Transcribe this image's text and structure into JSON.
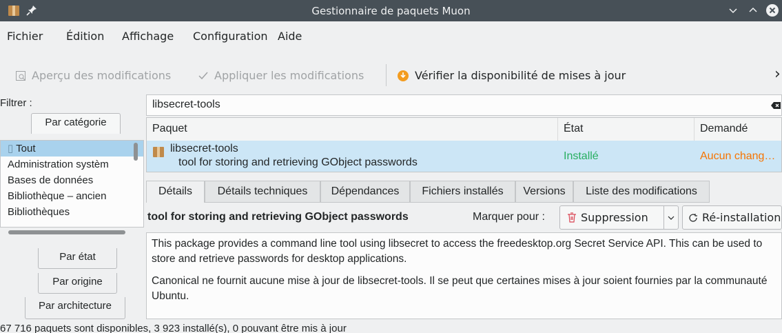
{
  "window": {
    "title": "Gestionnaire de paquets Muon"
  },
  "menubar": {
    "items": [
      "Fichier",
      "Édition",
      "Affichage",
      "Configuration",
      "Aide"
    ]
  },
  "toolbar": {
    "preview_label": "Aperçu des modifications",
    "apply_label": "Appliquer les modifications",
    "check_label": "Vérifier la disponibilité de mises à jour",
    "more_glyph": "›"
  },
  "filter": {
    "label": "Filtrer :",
    "tabs": {
      "category": "Par catégorie",
      "state": "Par état",
      "origin": "Par origine",
      "architecture": "Par architecture"
    },
    "categories": [
      "Tout",
      "Administration systèm",
      "Bases de données",
      "Bibliothèque – ancien",
      "Bibliothèques"
    ]
  },
  "search": {
    "value": "libsecret-tools"
  },
  "table": {
    "headers": {
      "package": "Paquet",
      "state": "État",
      "requested": "Demandé"
    },
    "row": {
      "name": "libsecret-tools",
      "summary": "tool for storing and retrieving GObject passwords",
      "state": "Installé",
      "requested": "Aucun chang…"
    }
  },
  "details": {
    "tabs": [
      "Détails",
      "Détails techniques",
      "Dépendances",
      "Fichiers installés",
      "Versions",
      "Liste des modifications"
    ],
    "title": "tool for storing and retrieving GObject passwords",
    "mark_label": "Marquer pour :",
    "remove_label": "Suppression",
    "reinstall_label": "Ré-installation",
    "description_1": "This package provides a command line tool using libsecret to access the freedesktop.org Secret Service API. This can be used to store and retrieve passwords for desktop applications.",
    "description_2": "Canonical ne fournit aucune mise à jour de libsecret-tools. Il se peut que certaines mises à jour soient fournies par la communauté Ubuntu."
  },
  "status": {
    "text": "67 716 paquets sont disponibles, 3 923 installé(s), 0 pouvant être mis à jour"
  },
  "colors": {
    "selection": "#a9d2ed",
    "installed": "#27ae60",
    "no_change": "#f67400",
    "titlebar": "#475057",
    "close": "#da4453"
  }
}
